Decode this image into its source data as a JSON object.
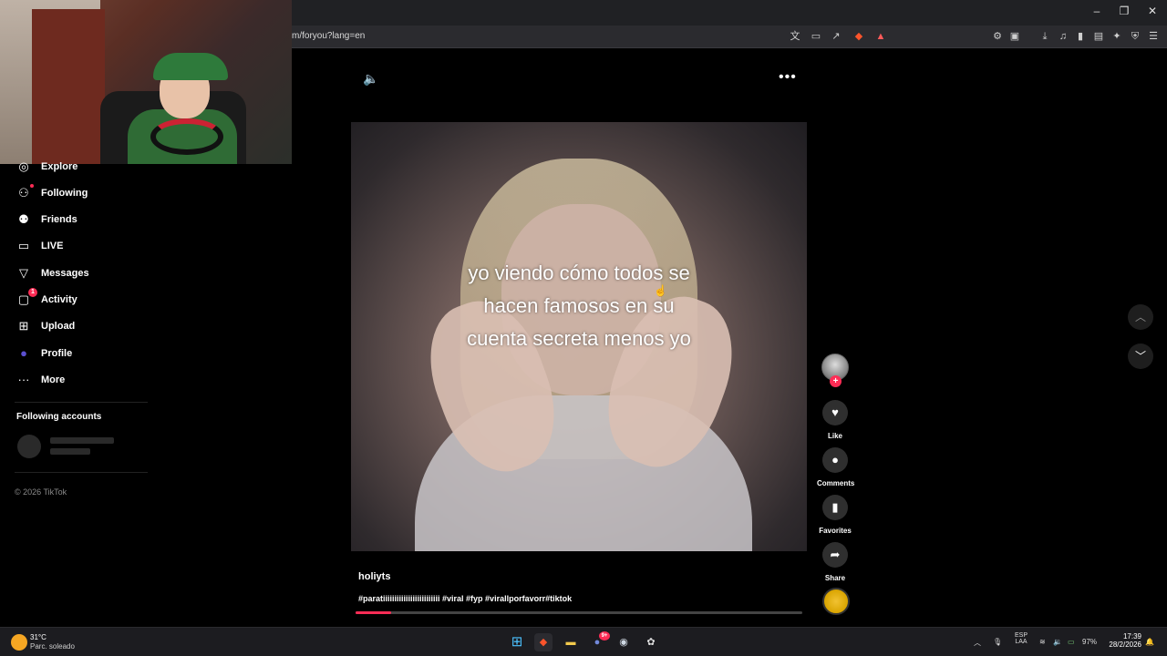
{
  "browser": {
    "url": "m/foryou?lang=en",
    "window_controls": [
      "–",
      "❐",
      "✕"
    ]
  },
  "sidebar": {
    "items": [
      {
        "label": "Explore",
        "icon": "compass-icon"
      },
      {
        "label": "Following",
        "icon": "following-icon"
      },
      {
        "label": "Friends",
        "icon": "friends-icon"
      },
      {
        "label": "LIVE",
        "icon": "live-icon"
      },
      {
        "label": "Messages",
        "icon": "messages-icon"
      },
      {
        "label": "Activity",
        "icon": "activity-icon",
        "badge": "1"
      },
      {
        "label": "Upload",
        "icon": "upload-icon"
      },
      {
        "label": "Profile",
        "icon": "profile-icon"
      },
      {
        "label": "More",
        "icon": "more-icon"
      }
    ],
    "following_accounts_title": "Following accounts",
    "copyright": "© 2026 TikTok"
  },
  "video": {
    "caption_lines": [
      "yo viendo cómo todos se",
      "hacen famosos en su",
      "cuenta secreta menos yo"
    ],
    "author": "holiyts",
    "description": "#paratiiiiiiiiiiiiiiiiiiiiiiiii #viral #fyp #virallporfavorr#tiktok",
    "progress_fraction": 0.08
  },
  "actions": {
    "like_label": "Like",
    "comments_label": "Comments",
    "favorites_label": "Favorites",
    "share_label": "Share",
    "follow_plus": "+"
  },
  "taskbar": {
    "weather_temp": "31°C",
    "weather_desc": "Parc. soleado",
    "lang_line1": "ESP",
    "lang_line2": "LAA",
    "battery": "97%",
    "time": "17:39",
    "date": "28/2/2026",
    "discord_badge": "9+"
  }
}
